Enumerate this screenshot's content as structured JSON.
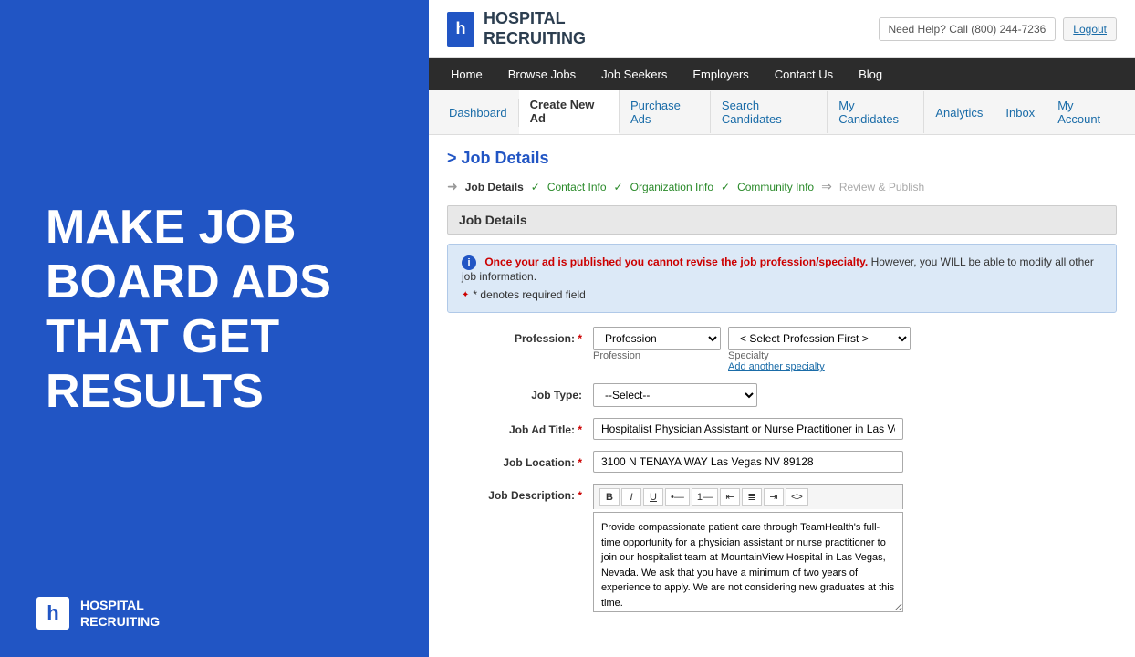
{
  "left": {
    "tagline": "Make Job Board Ads That Get Results",
    "logo_icon": "h",
    "logo_line1": "HOSPITAL",
    "logo_line2": "RECRUITING"
  },
  "header": {
    "logo_icon": "h",
    "logo_line1": "HOSPITAL",
    "logo_line2": "RECRUITING",
    "help_text": "Need Help? Call (800) 244-7236",
    "logout_label": "Logout"
  },
  "main_nav": {
    "items": [
      {
        "label": "Home"
      },
      {
        "label": "Browse Jobs"
      },
      {
        "label": "Job Seekers"
      },
      {
        "label": "Employers"
      },
      {
        "label": "Contact Us"
      },
      {
        "label": "Blog"
      }
    ]
  },
  "sub_nav": {
    "items": [
      {
        "label": "Dashboard",
        "active": false
      },
      {
        "label": "Create New Ad",
        "active": true
      },
      {
        "label": "Purchase Ads",
        "active": false
      },
      {
        "label": "Search Candidates",
        "active": false
      },
      {
        "label": "My Candidates",
        "active": false
      },
      {
        "label": "Analytics",
        "active": false
      },
      {
        "label": "Inbox",
        "active": false
      },
      {
        "label": "My Account",
        "active": false
      }
    ]
  },
  "page": {
    "title": "> Job Details",
    "steps": [
      {
        "label": "Job Details",
        "state": "current"
      },
      {
        "label": "Contact Info",
        "state": "done"
      },
      {
        "label": "Organization Info",
        "state": "done"
      },
      {
        "label": "Community Info",
        "state": "done"
      },
      {
        "label": "Review & Publish",
        "state": "future"
      }
    ],
    "section_label": "Job Details",
    "info_message": "Once your ad is published you cannot revise the job profession/specialty.",
    "info_message2": "However, you WILL be able to modify all other job information.",
    "required_note": "* denotes required field",
    "form": {
      "profession_label": "Profession:",
      "profession_value": "Profession",
      "profession_sub": "Profession",
      "specialty_placeholder": "< Select Profession First >",
      "specialty_sub": "Specialty",
      "add_specialty": "Add another specialty",
      "job_type_label": "Job Type:",
      "job_type_value": "--Select--",
      "job_title_label": "Job Ad Title:",
      "job_title_value": "Hospitalist Physician Assistant or Nurse Practitioner in Las Vegas, N…",
      "job_location_label": "Job Location:",
      "job_location_value": "3100 N TENAYA WAY Las Vegas NV 89128",
      "job_desc_label": "Job Description:",
      "job_desc_value": "Provide compassionate patient care through TeamHealth's full-time opportunity for a physician assistant or nurse practitioner to join our hospitalist team at MountainView Hospital in Las Vegas, Nevada. We ask that you have a minimum of two years of experience to apply. We are not considering new graduates at this time.\n\n- Comprehensive benefits package with health insurance and optional dental and vision insurance -",
      "toolbar_buttons": [
        "B",
        "I",
        "U",
        "≡",
        "≡",
        "≡",
        "≡",
        "≡",
        "<>"
      ]
    }
  }
}
